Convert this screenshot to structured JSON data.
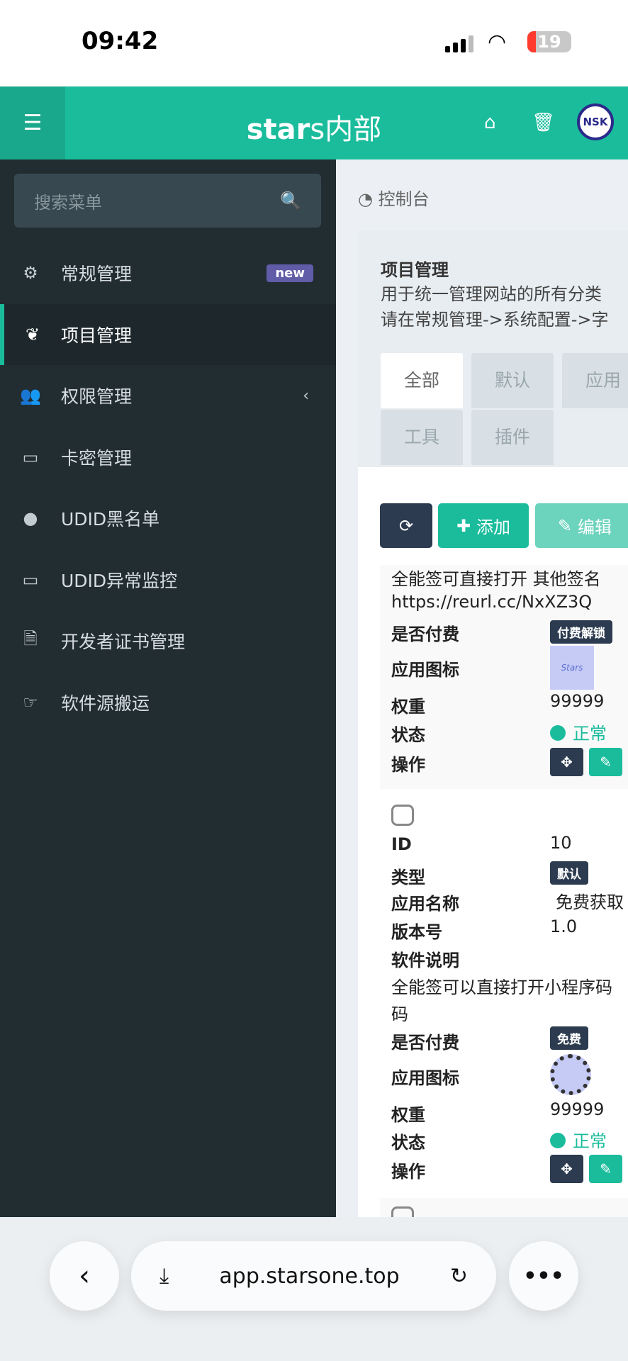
{
  "status_bar": {
    "time": "09:42",
    "battery": "19"
  },
  "header": {
    "brand_bold": "star",
    "brand_rest": "s内部",
    "avatar_text": "NSK"
  },
  "sidebar": {
    "search_placeholder": "搜索菜单",
    "items": [
      {
        "label": "常规管理",
        "icon": "cogs-icon",
        "badge": "new"
      },
      {
        "label": "项目管理",
        "icon": "leaf-icon",
        "active": true
      },
      {
        "label": "权限管理",
        "icon": "users-icon"
      },
      {
        "label": "卡密管理",
        "icon": "credit-card-icon"
      },
      {
        "label": "UDID黑名单",
        "icon": "bomb-icon"
      },
      {
        "label": "UDID异常监控",
        "icon": "desktop-icon"
      },
      {
        "label": "开发者证书管理",
        "icon": "file-excel-icon"
      },
      {
        "label": "软件源搬运",
        "icon": "hand-point-icon"
      }
    ]
  },
  "breadcrumb": "控制台",
  "panel": {
    "title": "项目管理",
    "desc1": "用于统一管理网站的所有分类",
    "desc2": "请在常规管理->系统配置->字",
    "tabs": [
      "全部",
      "默认",
      "应用",
      "工具",
      "插件"
    ],
    "toolbar": {
      "add": "添加",
      "edit": "编辑"
    }
  },
  "labels": {
    "id": "ID",
    "type": "类型",
    "name": "应用名称",
    "version": "版本号",
    "desc": "软件说明",
    "paid": "是否付费",
    "icon": "应用图标",
    "weight": "权重",
    "status": "状态",
    "ops": "操作"
  },
  "records": [
    {
      "desc": "全能签可直接打开 其他签名",
      "url": "https://reurl.cc/NxXZ3Q",
      "paid": "付费解锁",
      "icon_text": "Stars",
      "weight": "99999",
      "status": "正常"
    },
    {
      "id": "10",
      "type": "默认",
      "name": "免费获取",
      "version": "1.0",
      "desc": "全能签可以直接打开小程序码",
      "desc2": "码",
      "paid": "免费",
      "weight": "99999",
      "status": "正常"
    }
  ],
  "browser": {
    "url": "app.starsone.top"
  }
}
